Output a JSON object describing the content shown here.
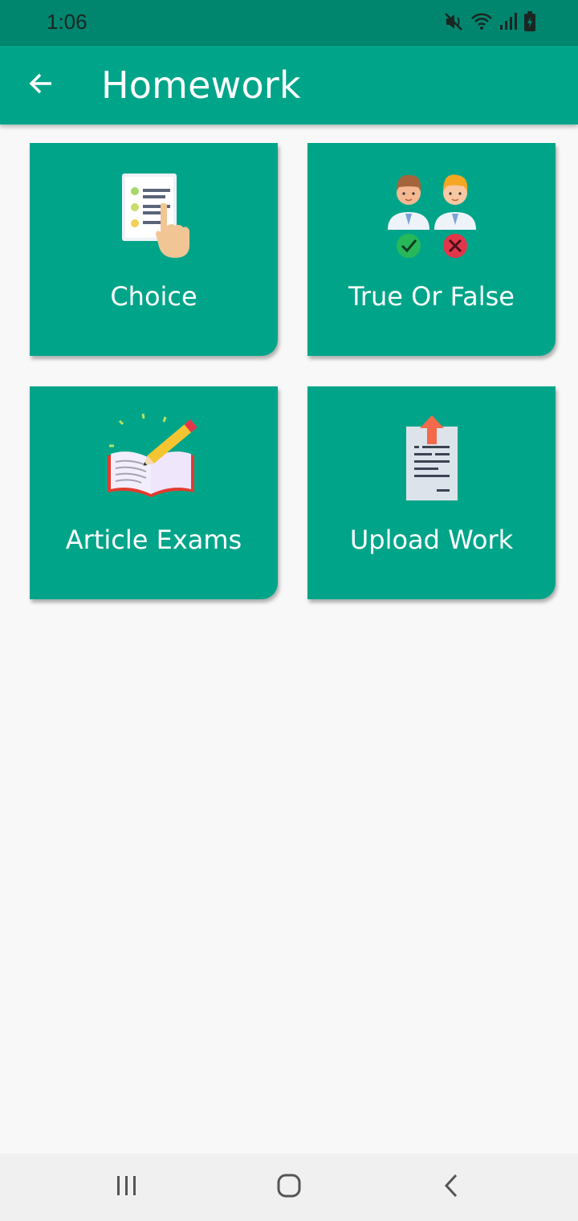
{
  "status_bar": {
    "time": "1:06",
    "icons": [
      "mute-icon",
      "wifi-icon",
      "signal-icon",
      "battery-charging-icon"
    ]
  },
  "app_bar": {
    "title": "Homework",
    "back_icon": "arrow-back-icon"
  },
  "cards": [
    {
      "label": "Choice",
      "icon": "checklist-hand-icon"
    },
    {
      "label": "True Or False",
      "icon": "two-students-check-cross-icon"
    },
    {
      "label": "Article Exams",
      "icon": "book-pencil-icon"
    },
    {
      "label": "Upload Work",
      "icon": "document-upload-icon"
    }
  ],
  "nav_bar": {
    "icons": [
      "recent-apps-icon",
      "home-icon",
      "back-nav-icon"
    ]
  },
  "colors": {
    "status_bar": "#00856e",
    "app_bar": "#00a589",
    "card": "#00a589",
    "background": "#f8f8f8"
  }
}
